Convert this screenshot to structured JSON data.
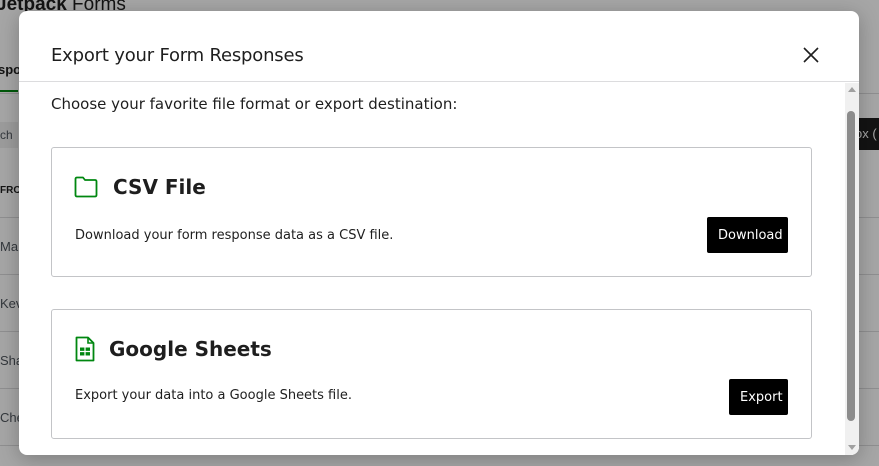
{
  "background": {
    "title_bold": "Jetpack",
    "title_light": " Forms",
    "tab_label": "spo",
    "search_text": "ch",
    "column_header": "FRO",
    "rows": [
      "Ma",
      "Kev",
      "Sha",
      "Che"
    ],
    "inbox_button": "ox ("
  },
  "modal": {
    "title": "Export your Form Responses",
    "close_icon": "close-icon",
    "intro": "Choose your favorite file format or export destination:",
    "csv": {
      "icon": "folder-icon",
      "title": "CSV File",
      "description": "Download your form response data as a CSV file.",
      "button": "Download"
    },
    "google_sheets": {
      "icon": "google-sheets-icon",
      "title": "Google Sheets",
      "description": "Export your data into a Google Sheets file.",
      "button": "Export"
    }
  },
  "colors": {
    "accent_green": "#008710",
    "button_bg": "#000000",
    "overlay": "rgba(0,0,0,0.35)"
  }
}
